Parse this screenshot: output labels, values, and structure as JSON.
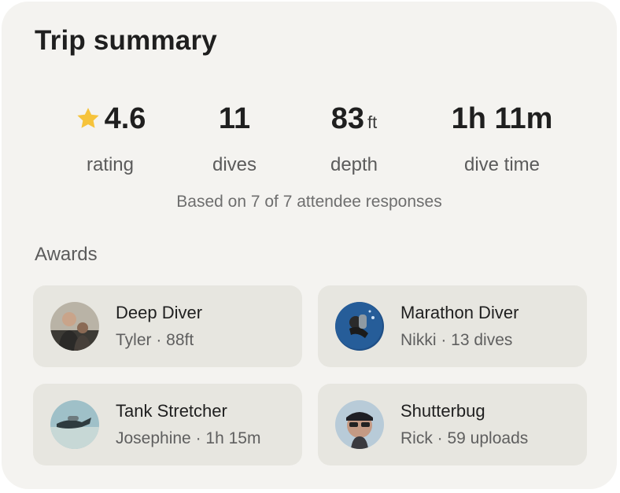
{
  "title": "Trip summary",
  "stats": [
    {
      "value": "4.6",
      "unit": "",
      "label": "rating",
      "icon": "star-icon"
    },
    {
      "value": "11",
      "unit": "",
      "label": "dives"
    },
    {
      "value": "83",
      "unit": "ft",
      "label": "depth"
    },
    {
      "value": "1h 11m",
      "unit": "",
      "label": "dive time"
    }
  ],
  "note": "Based on 7 of 7 attendee responses",
  "awards_label": "Awards",
  "awards": [
    {
      "title": "Deep Diver",
      "detail": "Tyler · 88ft"
    },
    {
      "title": "Marathon Diver",
      "detail": "Nikki · 13 dives"
    },
    {
      "title": "Tank Stretcher",
      "detail": "Josephine · 1h 15m"
    },
    {
      "title": "Shutterbug",
      "detail": "Rick · 59 uploads"
    }
  ],
  "colors": {
    "star": "#f6c33b",
    "card": "#f4f3f0",
    "award_bg": "#e7e6e0"
  }
}
